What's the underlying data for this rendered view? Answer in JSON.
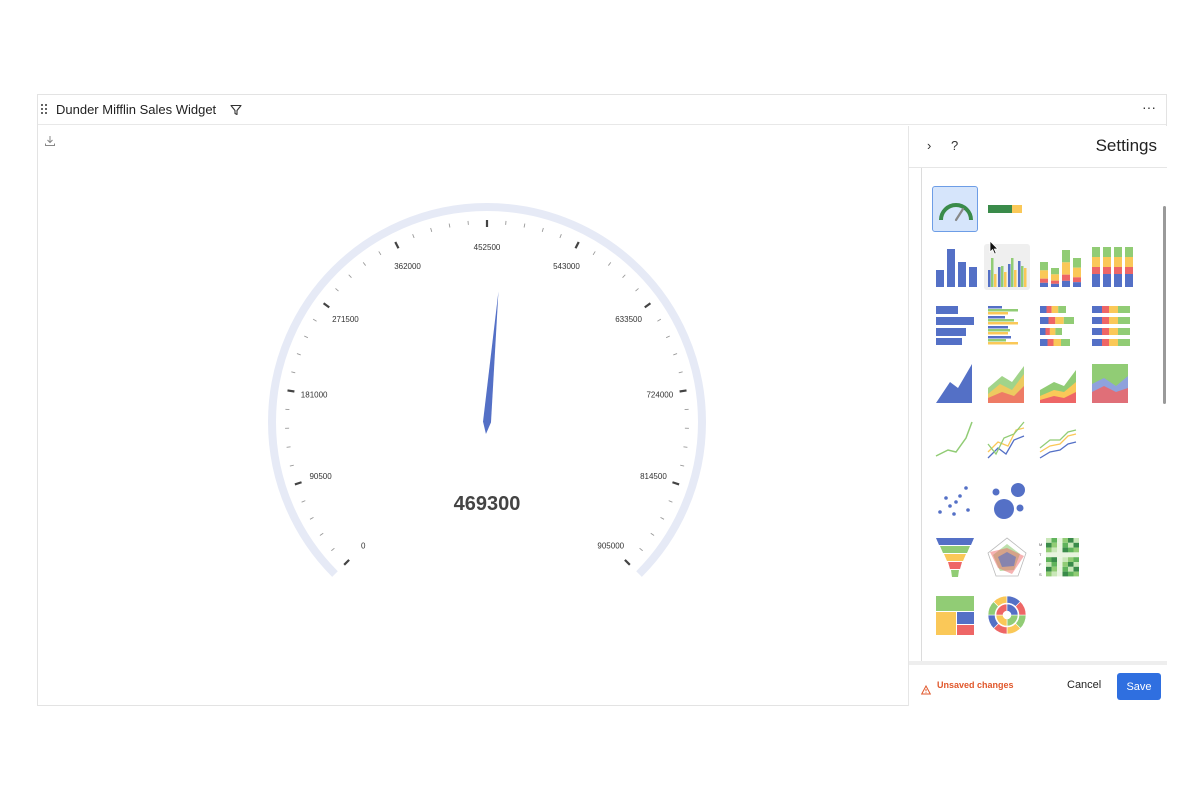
{
  "header": {
    "title": "Dunder Mifflin Sales Widget"
  },
  "gauge": {
    "value": 469300,
    "value_label": "469300",
    "min": 0,
    "max": 905000,
    "tick_labels": [
      "0",
      "90500",
      "181000",
      "271500",
      "362000",
      "452500",
      "543000",
      "633500",
      "724000",
      "814500",
      "905000"
    ],
    "colors": {
      "track": "#e6eaf6",
      "needle": "#5470c6",
      "tick": "#444444"
    }
  },
  "settings": {
    "title": "Settings",
    "collapse_icon": "chevron-right-icon",
    "help_label": "?",
    "chart_types": [
      "gauge",
      "progress-bar",
      "column",
      "grouped-column",
      "stacked-column",
      "stacked-column-100",
      "bar",
      "grouped-bar",
      "stacked-bar",
      "stacked-bar-100",
      "area",
      "overlapping-area",
      "stacked-area",
      "stacked-area-100",
      "line",
      "multi-line",
      "stacked-line",
      "scatter",
      "bubble",
      "funnel",
      "radar",
      "heatmap",
      "treemap",
      "sunburst"
    ],
    "selected_chart_type": "gauge"
  },
  "footer": {
    "unsaved_label": "Unsaved changes",
    "cancel_label": "Cancel",
    "save_label": "Save"
  },
  "colors": {
    "accent": "#2f6fe0",
    "warning": "#e0572b",
    "blue": "#5470c6",
    "green": "#91cc75",
    "yellow": "#fac858",
    "red": "#ee6666",
    "darkgreen": "#3a8b4a"
  }
}
